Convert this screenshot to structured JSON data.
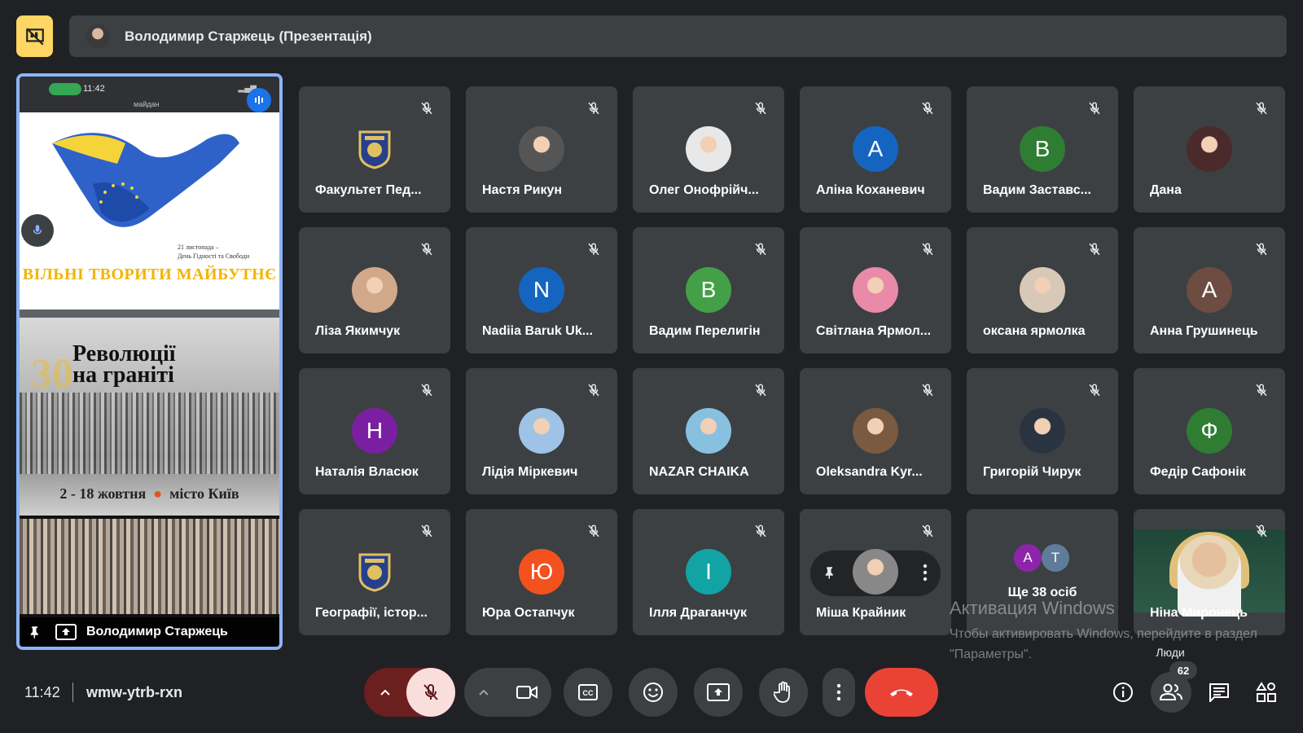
{
  "header": {
    "presenter_banner": "Володимир Старжець (Презентація)"
  },
  "presenter": {
    "name": "Володимир Старжець",
    "status_time": "11:42",
    "status_sub": "майдан",
    "slide1_date_line1": "21 листопада –",
    "slide1_date_line2": "День Гідності та Свободи",
    "slide1_heading": "ВІЛЬНІ ТВОРИТИ МАЙБУТНЄ",
    "slide2_title_line1": "Революції",
    "slide2_title_line2": "на граніті",
    "slide2_number": "30",
    "slide2_dates": "2 - 18 жовтня",
    "slide2_city": "місто Київ"
  },
  "participants": [
    {
      "name": "Факультет Пед...",
      "avatar": "crest",
      "color": "#3c4043",
      "icon": "crest-icon"
    },
    {
      "name": "Настя Рикун",
      "avatar": "photo",
      "color": "#555555",
      "icon": "photo-avatar-icon"
    },
    {
      "name": "Олег Онофрійч...",
      "avatar": "photo",
      "color": "#e8e8e8",
      "icon": "photo-avatar-icon"
    },
    {
      "name": "Аліна Коханевич",
      "avatar": "A",
      "color": "#1565c0"
    },
    {
      "name": "Вадим Заставс...",
      "avatar": "B",
      "color": "#2e7d32"
    },
    {
      "name": "Дана",
      "avatar": "photo",
      "color": "#4a2a2a",
      "icon": "photo-avatar-icon"
    },
    {
      "name": "Ліза Якимчук",
      "avatar": "photo",
      "color": "#d2a88a",
      "icon": "photo-avatar-icon"
    },
    {
      "name": "Nadiia Baruk Uk...",
      "avatar": "N",
      "color": "#1565c0"
    },
    {
      "name": "Вадим Перелигін",
      "avatar": "B",
      "color": "#43a047"
    },
    {
      "name": "Світлана Ярмол...",
      "avatar": "photo",
      "color": "#e88aa8",
      "icon": "photo-avatar-icon"
    },
    {
      "name": "оксана ярмолка",
      "avatar": "photo",
      "color": "#d8c8b8",
      "icon": "photo-avatar-icon"
    },
    {
      "name": "Анна Грушинець",
      "avatar": "A",
      "color": "#6d4c41"
    },
    {
      "name": "Наталія Власюк",
      "avatar": "H",
      "color": "#7b1fa2"
    },
    {
      "name": "Лідія Міркевич",
      "avatar": "photo",
      "color": "#9ec3e6",
      "icon": "photo-avatar-icon"
    },
    {
      "name": "NAZAR CHAIKA",
      "avatar": "photo",
      "color": "#88c0e0",
      "icon": "photo-avatar-icon"
    },
    {
      "name": "Oleksandra Kyr...",
      "avatar": "photo",
      "color": "#7a5a40",
      "icon": "photo-avatar-icon"
    },
    {
      "name": "Григорій Чирук",
      "avatar": "photo",
      "color": "#2a3440",
      "icon": "photo-avatar-icon"
    },
    {
      "name": "Федір Сафонік",
      "avatar": "Ф",
      "color": "#2e7d32"
    },
    {
      "name": "Географії, істор...",
      "avatar": "crest",
      "color": "#3c4043",
      "icon": "crest-icon"
    },
    {
      "name": "Юра Остапчук",
      "avatar": "Ю",
      "color": "#f4511e"
    },
    {
      "name": "Ілля Драганчук",
      "avatar": "І",
      "color": "#12a4a4"
    },
    {
      "name": "Міша Крайник",
      "avatar": "photo",
      "color": "#888888",
      "icon": "photo-avatar-icon",
      "hover": true
    }
  ],
  "more_tile": {
    "label": "Ще 38 осіб",
    "avatars": [
      {
        "letter": "A",
        "color": "#8e24aa"
      },
      {
        "letter": "T",
        "color": "#5f7d9a"
      }
    ]
  },
  "video_tile": {
    "name": "Ніна Миронець"
  },
  "watermark": {
    "title": "Активация Windows",
    "sub": "Чтобы активировать Windows, перейдите в раздел \"Параметры\"."
  },
  "tooltip": "Люди",
  "footer": {
    "time": "11:42",
    "meeting_code": "wmw-ytrb-rxn",
    "people_count": "62"
  },
  "colors": {
    "background": "#202124",
    "tile": "#3c4043",
    "accent": "#8ab4f8",
    "end_call": "#ea4335",
    "mic_off": "#f9dedc"
  }
}
